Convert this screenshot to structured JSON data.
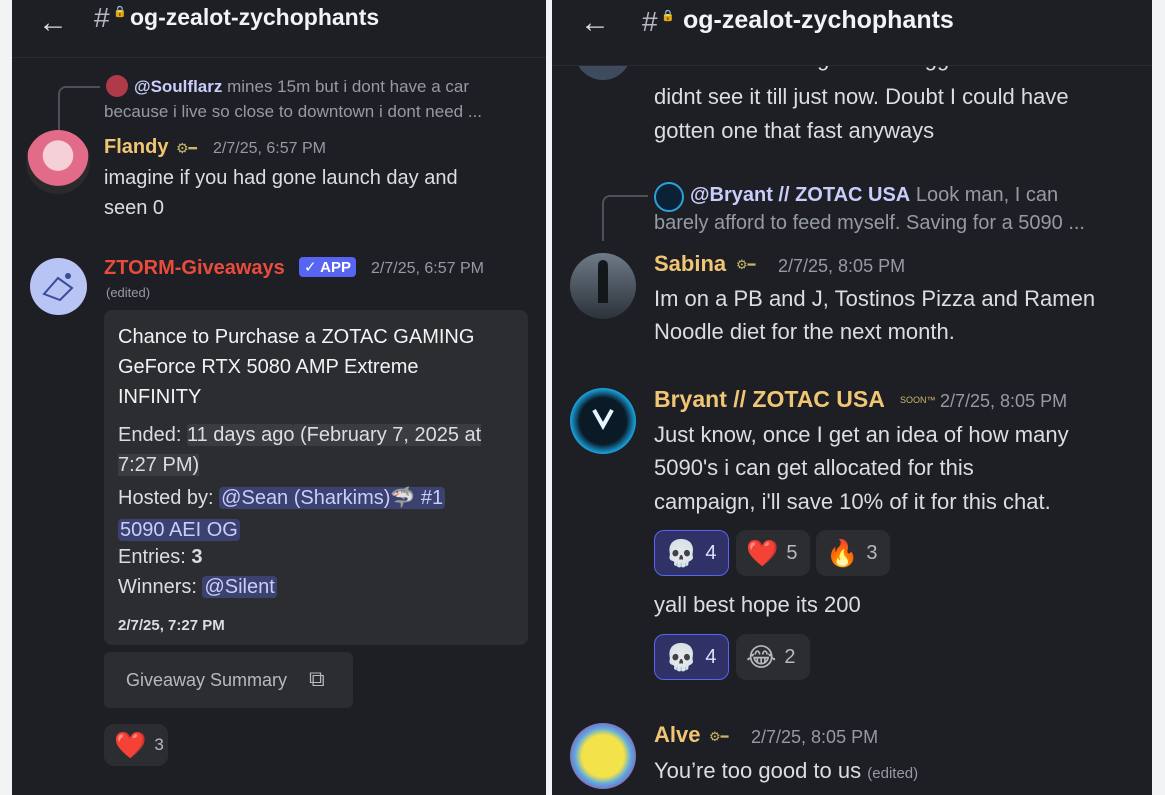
{
  "left": {
    "header": {
      "title": "og-zealot-zychophants"
    },
    "reply": {
      "name": "@Soulflarz",
      "text": "mines 15m but i dont have a car because i live so close to downtown i dont need ...",
      "line1": "mines 15m but i dont have a car",
      "line2": "because i live so close to downtown i dont need ..."
    },
    "msg1": {
      "author": "Flandy",
      "time": "2/7/25, 6:57 PM",
      "line1": "imagine if you had gone launch day and",
      "line2": "seen 0"
    },
    "msg2": {
      "author": "ZTORM-Giveaways",
      "app_tag": "✓ APP",
      "time": "2/7/25, 6:57 PM",
      "edited": "(edited)",
      "embed": {
        "title1": "Chance to Purchase a ZOTAC GAMING",
        "title2": "GeForce RTX 5080 AMP Extreme",
        "title3": "INFINITY",
        "ended_label": "Ended: ",
        "ended_rel": "11 days ago",
        "ended_date1": " (February 7, 2025 at",
        "ended_date2": "7:27 PM)",
        "hosted_label": "Hosted by: ",
        "host1": "@Sean (Sharkims)🦈 #1",
        "host2": "5090 AEI OG",
        "entries_label": "Entries: ",
        "entries_value": "3",
        "winners_label": "Winners: ",
        "winner": "@Silent",
        "footer_time": "2/7/25, 7:27 PM"
      },
      "button_label": "Giveaway Summary",
      "reaction": {
        "emoji": "❤️",
        "count": "3"
      }
    }
  },
  "right": {
    "header": {
      "title": "og-zealot-zychophants"
    },
    "cut_msg": {
      "line0": "wow. I'm following the newegg twitter and I",
      "line1": "didnt see it till just now. Doubt I could have",
      "line2": "gotten one that fast anyways"
    },
    "reply": {
      "name": "@Bryant // ZOTAC USA",
      "line1": "Look man, I can",
      "line2": "barely afford to feed myself. Saving for a 5090 ..."
    },
    "msg_sabina": {
      "author": "Sabina",
      "time": "2/7/25, 8:05 PM",
      "line1": "Im on a PB and J, Tostinos Pizza and Ramen",
      "line2": "Noodle diet for the next month."
    },
    "msg_bryant": {
      "author": "Bryant // ZOTAC USA",
      "badge": "SOON™",
      "time": "2/7/25, 8:05 PM",
      "line1": "Just know, once I get an idea of how many",
      "line2": "5090's i can get allocated for this",
      "line3": "campaign, i'll save 10% of it for this chat.",
      "reactions": [
        {
          "emoji": "💀",
          "count": "4"
        },
        {
          "emoji": "❤️",
          "count": "5"
        },
        {
          "emoji": "🔥",
          "count": "3"
        }
      ],
      "followup": "yall best hope its 200",
      "reactions2": [
        {
          "emoji": "💀",
          "count": "4"
        },
        {
          "emoji": "😂",
          "count": "2"
        }
      ]
    },
    "msg_alve": {
      "author": "Alve",
      "time": "2/7/25, 8:05 PM",
      "text": "You’re too good to us",
      "edited": "(edited)"
    }
  },
  "colors": {
    "background": "#1e1f24",
    "embed": "#2b2d31",
    "mention": "#3c4270",
    "ztorm_red": "#e74c3c",
    "gold_name": "#f0c674",
    "accent": "#5865f2"
  }
}
